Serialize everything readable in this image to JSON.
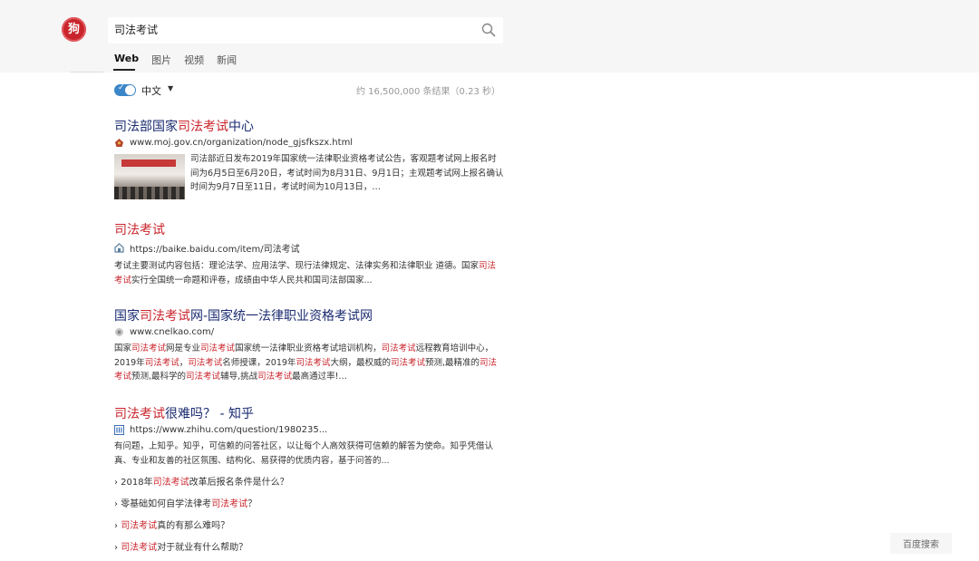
{
  "brand": {
    "logo_text": "狗"
  },
  "search": {
    "query": "司法考试"
  },
  "tabs": [
    {
      "label": "Web",
      "active": true
    },
    {
      "label": "图片",
      "active": false
    },
    {
      "label": "视频",
      "active": false
    },
    {
      "label": "新闻",
      "active": false
    }
  ],
  "filter": {
    "toggle_on": true,
    "language": "中文",
    "result_count": "约 16,500,000 条结果（0.23 秒）"
  },
  "results": [
    {
      "title": [
        "司法部国家",
        "司法考试",
        "中心"
      ],
      "url": "www.moj.gov.cn/organization/node_gjsfkszx.html",
      "favicon": "moj-emblem-icon",
      "snippet": "司法部近日发布2019年国家统一法律职业资格考试公告，客观题考试网上报名时间为6月5日至6月20日，考试时间为8月31日、9月1日；主观题考试网上报名确认时间为9月7日至11日，考试时间为10月13日，…"
    },
    {
      "title": [
        "",
        "司法考试",
        ""
      ],
      "url": "https://baike.baidu.com/item/司法考试",
      "favicon": "baike-icon",
      "snippet": "考试主要测试内容包括：理论法学、应用法学、现行法律规定、法律实务和法律职业 道德。国家司法考试实行全国统一命题和评卷，成绩由中华人民共和国司法部国家..."
    },
    {
      "title": [
        "国家",
        "司法考试",
        "网-国家统一法律职业资格考试网"
      ],
      "url": "www.cnelkao.com/",
      "favicon": "site-globe-icon",
      "snippet": "国家司法考试网是专业司法考试国家统一法律职业资格考试培训机构，司法考试远程教育培训中心，2019年司法考试，司法考试名师授课，2019年司法考试大纲，最权威的司法考试预测,最精准的司法考试预测,最科学的司法考试辅导,挑战司法考试最高通过率!…"
    },
    {
      "title": [
        "",
        "司法考试",
        "很难吗？ - 知乎"
      ],
      "url": "https://www.zhihu.com/question/1980235...",
      "favicon": "zhihu-icon",
      "snippet": "有问题，上知乎。知乎，可信赖的问答社区，以让每个人高效获得可信赖的解答为使命。知乎凭借认真、专业和友善的社区氛围、结构化、易获得的优质内容，基于问答的...",
      "sub_links": [
        "› 2018年司法考试改革后报名条件是什么？",
        "› 零基础如何自学法律考司法考试？",
        "› 司法考试真的有那么难吗？",
        "› 司法考试对于就业有什么帮助？"
      ]
    }
  ],
  "footer": {
    "button_label": "百度搜索"
  }
}
